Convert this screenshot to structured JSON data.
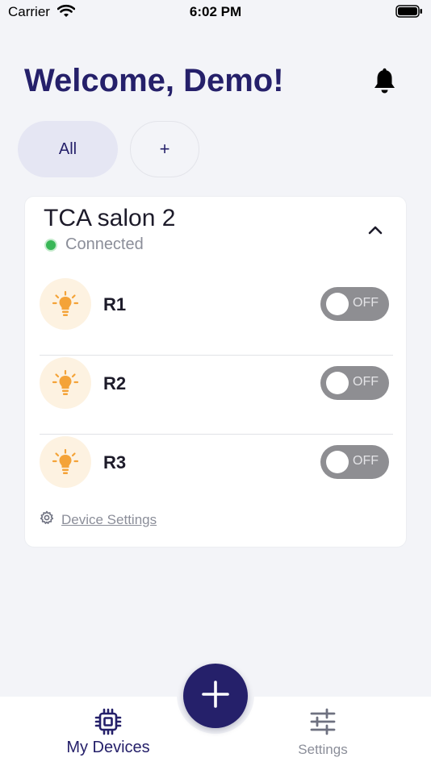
{
  "status_bar": {
    "carrier": "Carrier",
    "time": "6:02 PM"
  },
  "header": {
    "title": "Welcome, Demo!",
    "bell_icon": "bell-icon"
  },
  "filters": {
    "all_label": "All",
    "add_label": "+"
  },
  "device_card": {
    "title": "TCA salon 2",
    "connection_status": "Connected",
    "status_color": "#38b656",
    "relays": [
      {
        "name": "R1",
        "state_label": "OFF",
        "icon": "lightbulb-icon"
      },
      {
        "name": "R2",
        "state_label": "OFF",
        "icon": "lightbulb-icon"
      },
      {
        "name": "R3",
        "state_label": "OFF",
        "icon": "lightbulb-icon"
      }
    ],
    "settings_link": "Device Settings"
  },
  "tab_bar": {
    "tabs": [
      {
        "label": "My Devices",
        "icon": "chip-icon",
        "active": true
      },
      {
        "label": "Settings",
        "icon": "sliders-icon",
        "active": false
      }
    ],
    "fab_icon": "plus-icon"
  },
  "colors": {
    "brand": "#25206a",
    "background": "#f3f4f8",
    "bulb": "#f4a338",
    "toggle_off": "#8e8e92"
  }
}
